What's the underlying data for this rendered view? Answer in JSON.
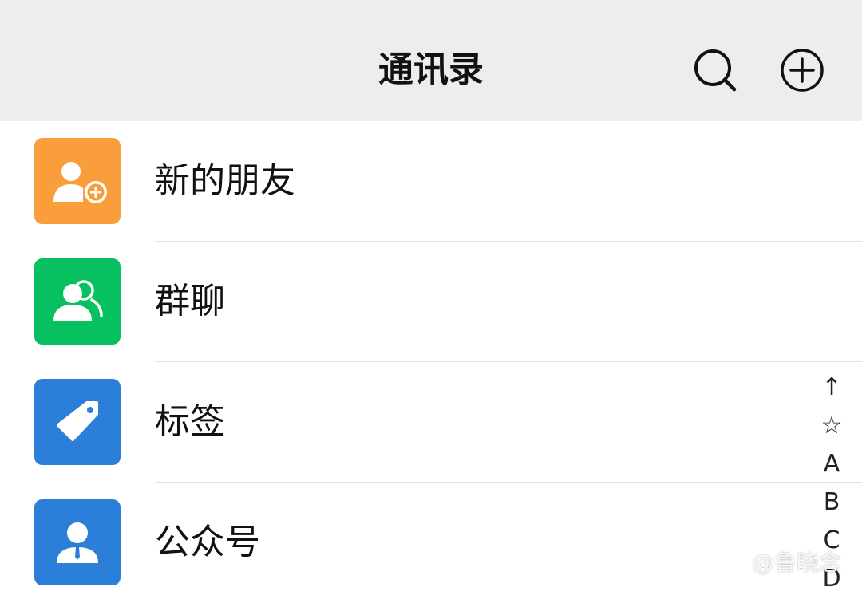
{
  "header": {
    "title": "通讯录",
    "search_icon": "search-icon",
    "add_icon": "add-circle-icon"
  },
  "items": [
    {
      "label": "新的朋友",
      "icon": "add-friend-icon",
      "color": "#fa9d3b"
    },
    {
      "label": "群聊",
      "icon": "group-chat-icon",
      "color": "#07c160"
    },
    {
      "label": "标签",
      "icon": "tag-icon",
      "color": "#2b7fd9"
    },
    {
      "label": "公众号",
      "icon": "official-account-icon",
      "color": "#2b7fd9"
    }
  ],
  "index_bar": [
    "↑",
    "☆",
    "A",
    "B",
    "C",
    "D"
  ],
  "watermark": "@鲁晓念"
}
